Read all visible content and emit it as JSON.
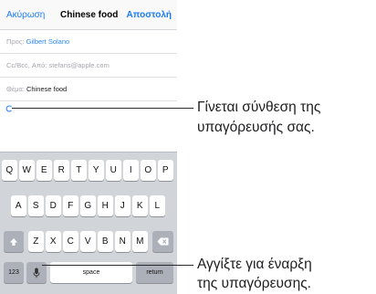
{
  "nav": {
    "cancel_label": "Ακύρωση",
    "title": "Chinese food",
    "send_label": "Αποστολή"
  },
  "fields": {
    "to_label": "Προς:",
    "to_value": "Gilbert Solano",
    "cc_label": "Cc/Bcc, Από:",
    "cc_value": "stefans@apple.com",
    "subject_label": "Θέμα:",
    "subject_value": "Chinese food"
  },
  "keyboard": {
    "row1": [
      "Q",
      "W",
      "E",
      "R",
      "T",
      "Y",
      "U",
      "I",
      "O",
      "P"
    ],
    "row2": [
      "A",
      "S",
      "D",
      "F",
      "G",
      "H",
      "J",
      "K",
      "L"
    ],
    "row3": [
      "Z",
      "X",
      "C",
      "V",
      "B",
      "N",
      "M"
    ],
    "numbers_label": "123",
    "space_label": "space",
    "return_label": "return"
  },
  "callouts": {
    "dictation_line1": "Γίνεται σύνθεση της",
    "dictation_line2": "υπαγόρευσής σας.",
    "mic_line1": "Αγγίξτε για έναρξη",
    "mic_line2": "της υπαγόρευσης."
  },
  "colors": {
    "accent": "#1a7cf5",
    "keyboard_bg": "#d1d4d9"
  },
  "icons": {
    "dictation_indicator": "dictation-spinner-icon",
    "shift": "shift-icon",
    "delete": "delete-icon",
    "microphone": "microphone-icon"
  }
}
